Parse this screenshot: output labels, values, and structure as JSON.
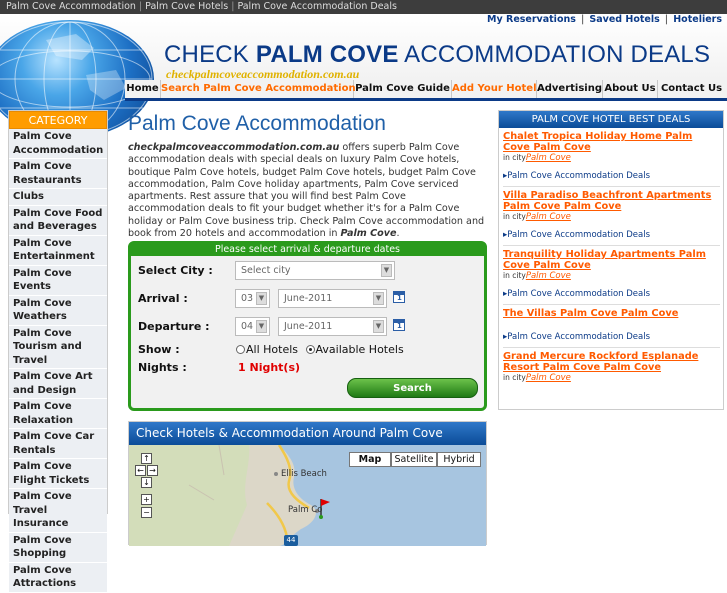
{
  "topbar": {
    "links": [
      "Palm Cove Accommodation",
      "Palm Cove Hotels",
      "Palm Cove Accommodation Deals"
    ]
  },
  "header": {
    "toplinks": [
      "My Reservations",
      "Saved Hotels",
      "Hoteliers"
    ],
    "brand_normal_1": "CHECK ",
    "brand_bold": "PALM COVE",
    "brand_normal_2": " ACCOMMODATION DEALS",
    "url": "checkpalmcoveaccommodation.com.au"
  },
  "nav": [
    "Home",
    "Search Palm Cove Accommodation",
    "Palm Cove Guide",
    "Add Your Hotel",
    "Advertising",
    "About Us",
    "Contact Us"
  ],
  "sidebar": {
    "title": "CATEGORY",
    "items": [
      "Palm Cove Accommodation",
      "Palm Cove Restaurants",
      "Clubs",
      "Palm Cove Food and Beverages",
      "Palm Cove Entertainment",
      "Palm Cove Events",
      "Palm Cove Weathers",
      "Palm Cove Tourism and Travel",
      "Palm Cove Art and Design",
      "Palm Cove Relaxation",
      "Palm Cove Car Rentals",
      "Palm Cove Flight Tickets",
      "Palm Cove Travel Insurance",
      "Palm Cove Shopping",
      "Palm Cove Attractions"
    ]
  },
  "main": {
    "title": "Palm Cove Accommodation",
    "intro_site": "checkpalmcoveaccommodation.com.au",
    "intro_body": " offers superb Palm Cove accommodation deals with special deals on luxury Palm Cove hotels, boutique Palm Cove hotels, budget Palm Cove hotels, budget Palm Cove accommodation, Palm Cove holiday apartments, Palm Cove serviced apartments. Rest assure that you will find best Palm Cove accommodation deals to fit your budget whether it's for a Palm Cove holiday or Palm Cove business trip. Check Palm Cove accommodation and book from 20 hotels and accommodation in ",
    "intro_end": "Palm Cove",
    "intro_period": "."
  },
  "search": {
    "header": "Please select arrival & departure dates",
    "city_label": "Select City :",
    "city_value": "Select city",
    "arrival_label": "Arrival :",
    "arrival_day": "03",
    "arrival_month": "June-2011",
    "departure_label": "Departure :",
    "departure_day": "04",
    "departure_month": "June-2011",
    "show_label": "Show :",
    "opt_all": "All Hotels",
    "opt_available": "Available Hotels",
    "nights_label": "Nights :",
    "nights_value": "1 Night(s)",
    "button": "Search"
  },
  "mapsection": {
    "title": "Check Hotels & Accommodation Around Palm Cove",
    "buttons": [
      "Map",
      "Satellite",
      "Hybrid"
    ],
    "labels": {
      "ellis": "Ellis Beach",
      "palm": "Palm Co",
      "road": "44"
    }
  },
  "deals": {
    "title": "PALM COVE HOTEL BEST DEALS",
    "city_prefix": "in city",
    "items": [
      {
        "name": "Chalet Tropica Holiday Home Palm Cove Palm Cove",
        "city": "Palm Cove",
        "link": "Palm Cove Accommodation Deals"
      },
      {
        "name": "Villa Paradiso Beachfront Apartments Palm Cove Palm Cove",
        "city": "Palm Cove",
        "link": "Palm Cove Accommodation Deals"
      },
      {
        "name": "Tranquility Holiday Apartments Palm Cove Palm Cove",
        "city": "Palm Cove",
        "link": "Palm Cove Accommodation Deals"
      },
      {
        "name": "The Villas Palm Cove Palm Cove",
        "city": "",
        "link": "Palm Cove Accommodation Deals"
      },
      {
        "name": "Grand Mercure Rockford Esplanade Resort Palm Cove Palm Cove",
        "city": "Palm Cove",
        "link": ""
      }
    ]
  },
  "colors": {
    "brand_blue": "#0b3a87",
    "orange": "#ff9c00",
    "green": "#2a9a1c",
    "accent": "#ff5a00"
  }
}
